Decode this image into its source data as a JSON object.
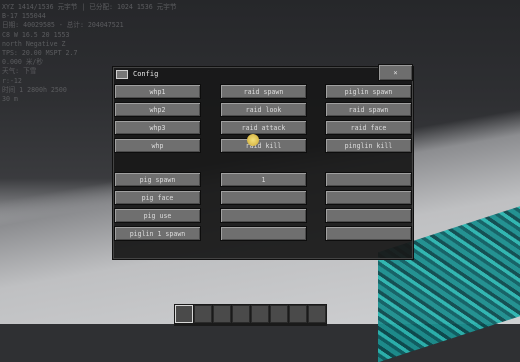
{
  "hud": {
    "debug_lines": [
      "XYZ 1414/1536 元宇节 | 已分配: 1024 1536 元宇节",
      "B-17 155044",
      "日期: 40029585 - 总计: 204047521",
      "C8 W 16.5 20 1553",
      "north Negative Z",
      "TPS: 20.00 MSPT 2.7",
      "0.000 米/秒",
      "天气: 下雪",
      "r:-12",
      "时间 1 2800h 2500",
      "30 m"
    ]
  },
  "dialog": {
    "title": "Config",
    "close_label": "×",
    "columns": [
      {
        "top": [
          "whp1",
          "whp2",
          "whp3",
          "whp"
        ],
        "bottom": [
          "pig spawn",
          "pig face",
          "pig use",
          "piglin 1 spawn"
        ]
      },
      {
        "top": [
          "raid spawn",
          "raid look",
          "raid attack",
          "raid kill"
        ],
        "bottom": [
          "1",
          "",
          "",
          ""
        ]
      },
      {
        "top": [
          "piglin spawn",
          "raid spawn",
          "raid face",
          "pinglin kill"
        ],
        "bottom": [
          "",
          "",
          "",
          ""
        ]
      }
    ]
  },
  "colors": {
    "button_bg": "#6f6f6f",
    "button_text": "#dcdcdc",
    "dialog_bg": "#181818"
  },
  "icons": {
    "title": "window-icon",
    "close": "close-icon",
    "cursor": "mouse-cursor-icon"
  }
}
